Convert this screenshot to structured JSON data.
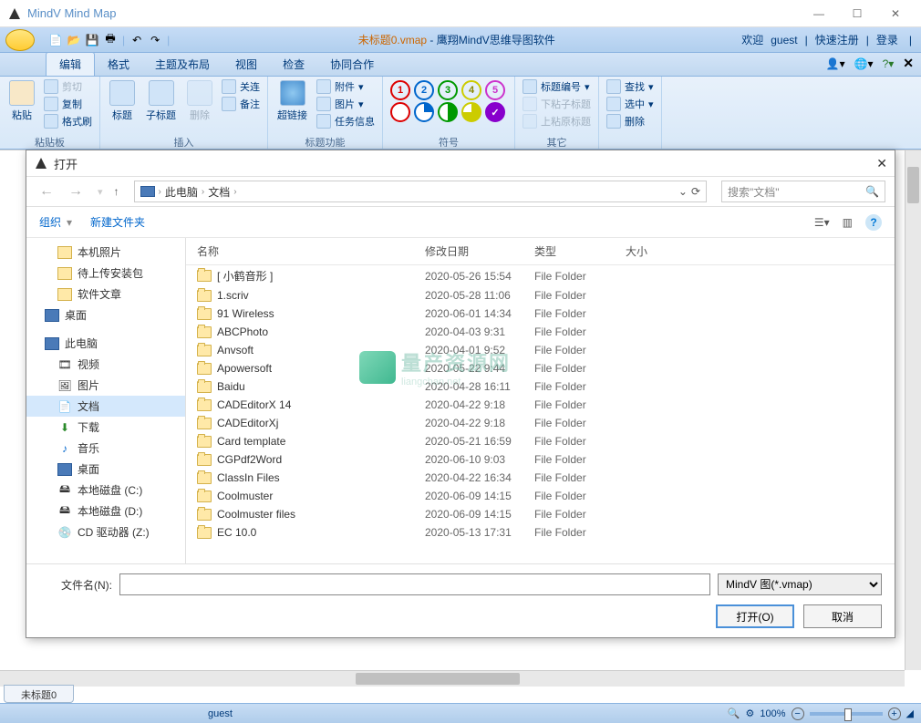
{
  "app": {
    "title": "MindV Mind Map"
  },
  "doc": {
    "filename": "未标题0.vmap",
    "suffix": " - 鹰翔MindV思维导图软件"
  },
  "welcome": {
    "prefix": "欢迎 ",
    "user": "guest",
    "sep": " | ",
    "register": "快速注册",
    "login": "登录"
  },
  "tabs": {
    "edit": "编辑",
    "format": "格式",
    "theme": "主题及布局",
    "view": "视图",
    "check": "检查",
    "collab": "协同合作"
  },
  "ribbon": {
    "paste": "粘贴",
    "cut": "剪切",
    "copy": "复制",
    "format_painter": "格式刷",
    "clipboard": "粘贴板",
    "topic": "标题",
    "subtopic": "子标题",
    "delete": "删除",
    "insert_label": "插入",
    "relation": "关连",
    "note": "备注",
    "hyperlink": "超链接",
    "image": "图片",
    "attachment": "附件",
    "taskinfo": "任务信息",
    "topic_funcs": "标题功能",
    "symbol_label": "符号",
    "title_number": "标题编号",
    "paste_link_below": "下粘子标题",
    "paste_link_above": "上粘原标题",
    "other_label": "其它",
    "find": "查找",
    "select": "选中",
    "delete2": "删除"
  },
  "dialog": {
    "title": "打开",
    "breadcrumb": {
      "root": "此电脑",
      "folder": "文档"
    },
    "search_placeholder": "搜索\"文档\"",
    "organize": "组织",
    "new_folder": "新建文件夹",
    "columns": {
      "name": "名称",
      "date": "修改日期",
      "type": "类型",
      "size": "大小"
    },
    "tree": {
      "local_photos": "本机照片",
      "pending_upload": "待上传安装包",
      "software_articles": "软件文章",
      "desktop1": "桌面",
      "this_pc": "此电脑",
      "videos": "视频",
      "pictures": "图片",
      "documents": "文档",
      "downloads": "下载",
      "music": "音乐",
      "desktop2": "桌面",
      "disk_c": "本地磁盘 (C:)",
      "disk_d": "本地磁盘 (D:)",
      "cd_z": "CD 驱动器 (Z:)"
    },
    "files": [
      {
        "name": "[ 小鹤音形 ]",
        "date": "2020-05-26 15:54",
        "type": "File Folder"
      },
      {
        "name": "1.scriv",
        "date": "2020-05-28 11:06",
        "type": "File Folder"
      },
      {
        "name": "91 Wireless",
        "date": "2020-06-01 14:34",
        "type": "File Folder"
      },
      {
        "name": "ABCPhoto",
        "date": "2020-04-03 9:31",
        "type": "File Folder"
      },
      {
        "name": "Anvsoft",
        "date": "2020-04-01 9:52",
        "type": "File Folder"
      },
      {
        "name": "Apowersoft",
        "date": "2020-05-22 9:44",
        "type": "File Folder"
      },
      {
        "name": "Baidu",
        "date": "2020-04-28 16:11",
        "type": "File Folder"
      },
      {
        "name": "CADEditorX 14",
        "date": "2020-04-22 9:18",
        "type": "File Folder"
      },
      {
        "name": "CADEditorXj",
        "date": "2020-04-22 9:18",
        "type": "File Folder"
      },
      {
        "name": "Card template",
        "date": "2020-05-21 16:59",
        "type": "File Folder"
      },
      {
        "name": "CGPdf2Word",
        "date": "2020-06-10 9:03",
        "type": "File Folder"
      },
      {
        "name": "ClassIn Files",
        "date": "2020-04-22 16:34",
        "type": "File Folder"
      },
      {
        "name": "Coolmuster",
        "date": "2020-06-09 14:15",
        "type": "File Folder"
      },
      {
        "name": "Coolmuster files",
        "date": "2020-06-09 14:15",
        "type": "File Folder"
      },
      {
        "name": "EC 10.0",
        "date": "2020-05-13 17:31",
        "type": "File Folder"
      }
    ],
    "watermark": "量产资源网",
    "watermark_sub": "liangchan.net",
    "filename_label": "文件名(N):",
    "filter": "MindV 图(*.vmap)",
    "open_btn": "打开(O)",
    "cancel_btn": "取消"
  },
  "status": {
    "tab": "未标题0",
    "user": "guest",
    "zoom": "100%"
  }
}
